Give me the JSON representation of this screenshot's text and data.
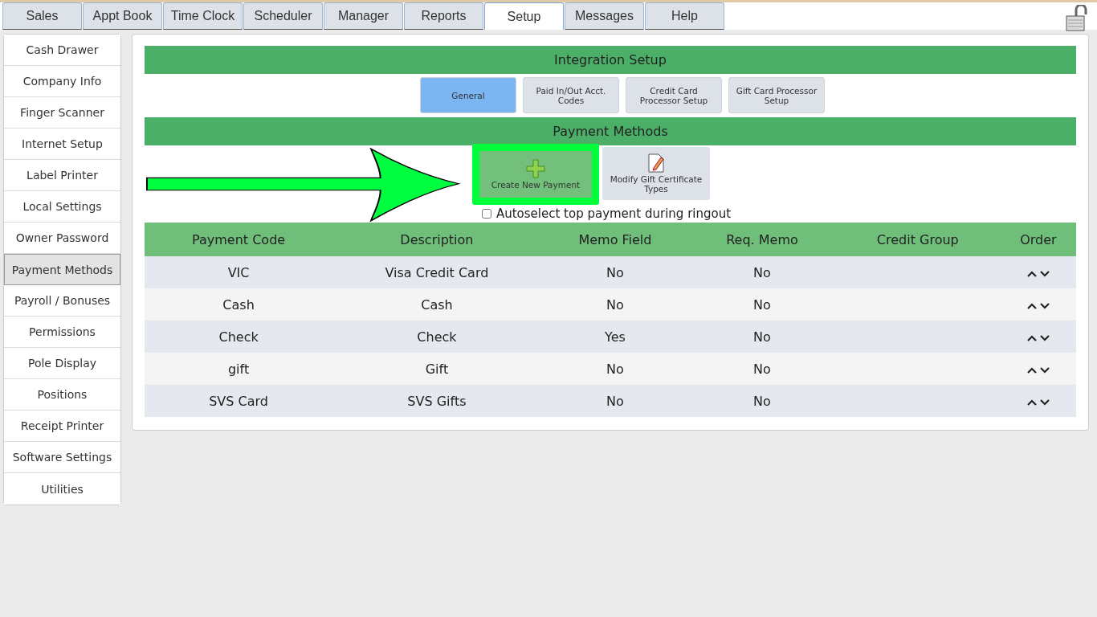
{
  "top_tabs": [
    {
      "label": "Sales",
      "selected": false
    },
    {
      "label": "Appt Book",
      "selected": false
    },
    {
      "label": "Time Clock",
      "selected": false
    },
    {
      "label": "Scheduler",
      "selected": false
    },
    {
      "label": "Manager",
      "selected": false
    },
    {
      "label": "Reports",
      "selected": false
    },
    {
      "label": "Setup",
      "selected": true
    },
    {
      "label": "Messages",
      "selected": false
    },
    {
      "label": "Help",
      "selected": false
    }
  ],
  "sidebar": {
    "items": [
      {
        "label": "Cash Drawer",
        "selected": false
      },
      {
        "label": "Company Info",
        "selected": false
      },
      {
        "label": "Finger Scanner",
        "selected": false
      },
      {
        "label": "Internet Setup",
        "selected": false
      },
      {
        "label": "Label Printer",
        "selected": false
      },
      {
        "label": "Local Settings",
        "selected": false
      },
      {
        "label": "Owner Password",
        "selected": false
      },
      {
        "label": "Payment Methods",
        "selected": true
      },
      {
        "label": "Payroll / Bonuses",
        "selected": false
      },
      {
        "label": "Permissions",
        "selected": false
      },
      {
        "label": "Pole Display",
        "selected": false
      },
      {
        "label": "Positions",
        "selected": false
      },
      {
        "label": "Receipt Printer",
        "selected": false
      },
      {
        "label": "Software Settings",
        "selected": false
      },
      {
        "label": "Utilities",
        "selected": false
      }
    ]
  },
  "integration": {
    "title": "Integration Setup",
    "tabs": [
      {
        "label": "General",
        "selected": true
      },
      {
        "label": "Paid In/Out Acct. Codes",
        "selected": false
      },
      {
        "label": "Credit Card Processor Setup",
        "selected": false
      },
      {
        "label": "Gift Card Processor Setup",
        "selected": false
      }
    ]
  },
  "payment_methods": {
    "title": "Payment Methods",
    "create_button": "Create New Payment",
    "modify_button": "Modify Gift Certificate Types",
    "autoselect": {
      "label": "Autoselect top payment during ringout",
      "checked": false
    }
  },
  "table": {
    "columns": [
      "Payment Code",
      "Description",
      "Memo Field",
      "Req. Memo",
      "Credit Group",
      "Order"
    ],
    "rows": [
      [
        "VIC",
        "Visa Credit Card",
        "No",
        "No",
        ""
      ],
      [
        "Cash",
        "Cash",
        "No",
        "No",
        ""
      ],
      [
        "Check",
        "Check",
        "Yes",
        "No",
        ""
      ],
      [
        "gift",
        "Gift",
        "No",
        "No",
        ""
      ],
      [
        "SVS Card",
        "SVS Gifts",
        "No",
        "No",
        ""
      ]
    ]
  }
}
